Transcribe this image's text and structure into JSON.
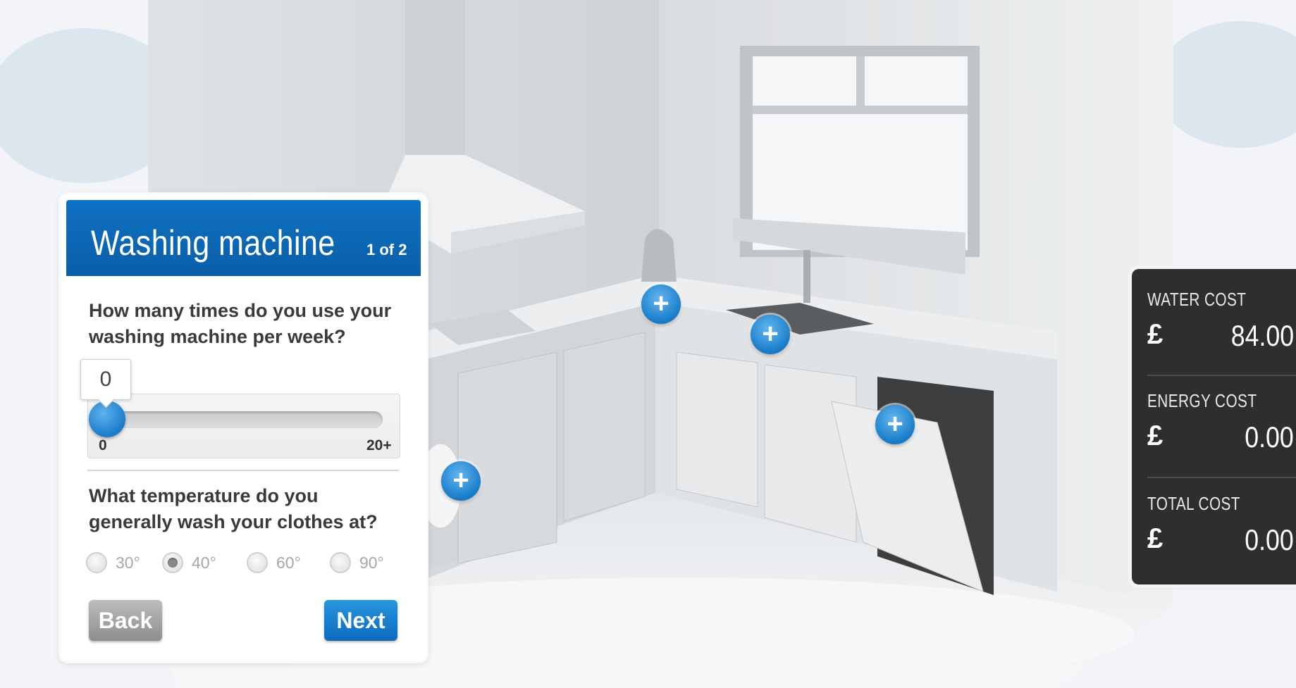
{
  "dialog": {
    "title": "Washing machine",
    "step": "1 of 2",
    "question_frequency": "How many times do you use your washing machine per week?",
    "slider": {
      "value": "0",
      "min_label": "0",
      "max_label": "20+",
      "fraction": 0
    },
    "question_temperature": "What temperature do you generally wash your clothes at?",
    "temperature_options": [
      "30°",
      "40°",
      "60°",
      "90°"
    ],
    "selected_temperature": "40°",
    "back_label": "Back",
    "next_label": "Next"
  },
  "costs": {
    "water_label": "WATER COST",
    "water_currency": "£",
    "water_value": "84.00",
    "energy_label": "ENERGY COST",
    "energy_currency": "£",
    "energy_value": "0.00",
    "total_label": "TOTAL COST",
    "total_currency": "£",
    "total_value": "0.00"
  },
  "hotspots": {
    "symbol": "+",
    "items": [
      "kettle",
      "sink",
      "dishwasher",
      "washing-machine"
    ]
  },
  "colors": {
    "accent_blue": "#0a62ad",
    "cost_panel_bg": "#2e2e2e",
    "back_button": "#9e9e9e",
    "next_button": "#1581cf"
  }
}
